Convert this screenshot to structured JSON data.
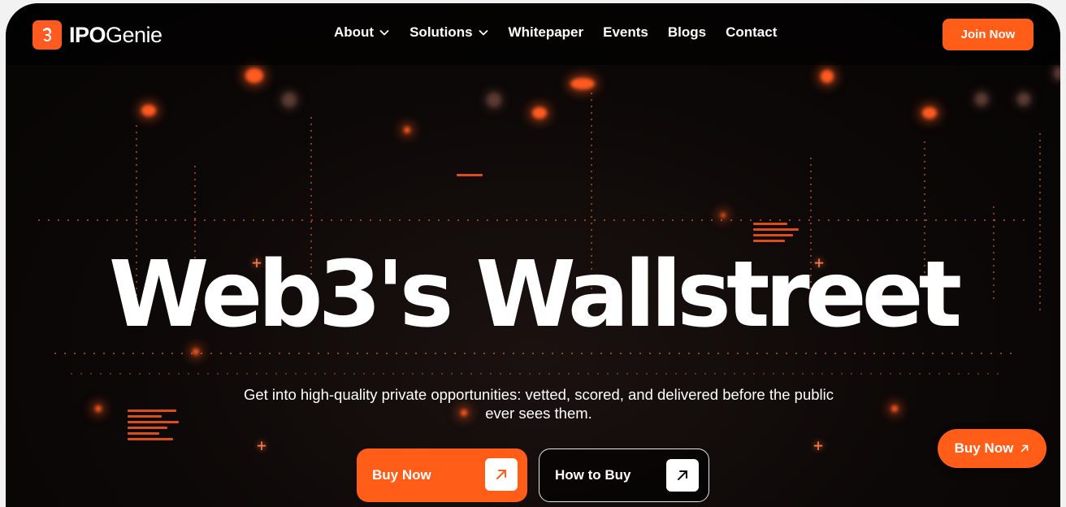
{
  "brand": {
    "name_bold": "IPO",
    "name_light": "Genie",
    "accent_color": "#ff5d18"
  },
  "nav": {
    "items": [
      {
        "label": "About",
        "has_dropdown": true
      },
      {
        "label": "Solutions",
        "has_dropdown": true
      },
      {
        "label": "Whitepaper",
        "has_dropdown": false
      },
      {
        "label": "Events",
        "has_dropdown": false
      },
      {
        "label": "Blogs",
        "has_dropdown": false
      },
      {
        "label": "Contact",
        "has_dropdown": false
      }
    ],
    "cta_label": "Join Now"
  },
  "hero": {
    "title": "Web3's Wallstreet",
    "subtitle_line1": "Get into high-quality private opportunities: vetted, scored, and delivered before the public",
    "subtitle_line2": "ever sees them.",
    "primary_button": {
      "label": "Buy Now",
      "icon": "arrow-up-right-icon"
    },
    "secondary_button": {
      "label": "How to Buy",
      "icon": "arrow-up-right-icon"
    }
  },
  "floating_button": {
    "label": "Buy Now",
    "icon": "arrow-up-right-icon"
  }
}
